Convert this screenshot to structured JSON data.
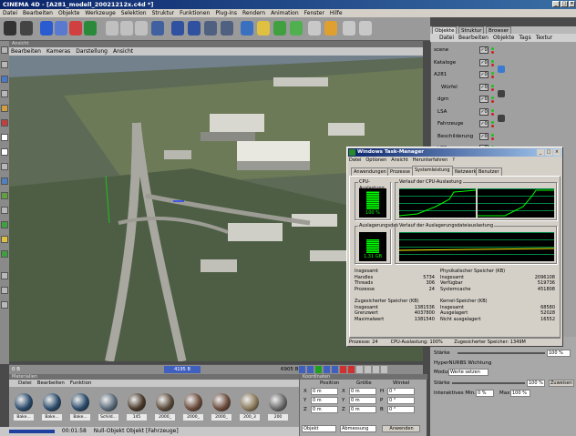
{
  "window": {
    "title": "CINEMA 4D - [A281_modell_20021212x.c4d *]"
  },
  "menubar": [
    "Datei",
    "Bearbeiten",
    "Objekte",
    "Werkzeuge",
    "Selektion",
    "Struktur",
    "Funktionen",
    "Plug-ins",
    "Rendern",
    "Animation",
    "Fenster",
    "Hilfe"
  ],
  "viewport": {
    "header": "Ansicht",
    "menu": [
      "Bearbeiten",
      "Kameras",
      "Darstellung",
      "Ansicht"
    ]
  },
  "timeline": {
    "start": "0 B",
    "current": "4195 B",
    "end": "6905 B"
  },
  "materials": {
    "header": "Materialien",
    "menu": [
      "Datei",
      "Bearbeiten",
      "Funktion"
    ],
    "items": [
      "Bake...",
      "Bake...",
      "Bake...",
      "Schild...",
      "145",
      "2000_",
      "2000_",
      "2000_",
      "200_3",
      "200"
    ]
  },
  "coords": {
    "header": "Koordinaten",
    "cols": [
      "Position",
      "Größe",
      "Winkel"
    ],
    "rows": [
      {
        "axis": "X",
        "pos": "0 m",
        "size": "0 m",
        "ang_axis": "H",
        "ang": "0 °"
      },
      {
        "axis": "Y",
        "pos": "0 m",
        "size": "0 m",
        "ang_axis": "P",
        "ang": "0 °"
      },
      {
        "axis": "Z",
        "pos": "0 m",
        "size": "0 m",
        "ang_axis": "B",
        "ang": "0 °"
      }
    ],
    "mode": "Objekt",
    "size_mode": "Abmessung",
    "apply": "Anwenden"
  },
  "status": {
    "time": "00:01:58",
    "text": "Null-Objekt Objekt [Fahrzeuge]"
  },
  "objects_panel": {
    "tabs": [
      "Objekte",
      "Struktur",
      "Browser"
    ],
    "menu": [
      "Datei",
      "Bearbeiten",
      "Objekte",
      "Tags",
      "Textur"
    ],
    "items": [
      {
        "name": "scene",
        "check": "✓0"
      },
      {
        "name": "Kataloge",
        "check": "✓0"
      },
      {
        "name": "A281",
        "check": "✓0"
      },
      {
        "name": "Würfel",
        "check": "✓0"
      },
      {
        "name": "dgm",
        "check": "✓0"
      },
      {
        "name": "LSA",
        "check": "✓0"
      },
      {
        "name": "Fahrzeuge",
        "check": "✓0"
      },
      {
        "name": "Beschilderung",
        "check": "✓0"
      },
      {
        "name": "LBP",
        "check": "✓0"
      }
    ]
  },
  "attributes": {
    "staerke_label": "Stärke",
    "staerke_val": "100 %",
    "hyper_title": "HyperNURBS Wichtung",
    "mode_label": "Modus",
    "mode_val": "Werte setzen",
    "staerke2_label": "Stärke",
    "staerke2_val": "100 %",
    "apply": "Zuweisen",
    "interactive_label": "Interaktives Min.",
    "min_val": "0 %",
    "max_label": "Max.",
    "max_val": "100 %"
  },
  "taskmgr": {
    "title": "Windows Task-Manager",
    "menu": [
      "Datei",
      "Optionen",
      "Ansicht",
      "Herunterfahren",
      "?"
    ],
    "tabs": [
      "Anwendungen",
      "Prozesse",
      "Systemleistung",
      "Netzwerk",
      "Benutzer"
    ],
    "cpu_label": "CPU-Auslastung",
    "cpu_value": "100 %",
    "cpu_hist_label": "Verlauf der CPU-Auslastung",
    "pf_label": "Auslagerungsdatei",
    "pf_value": "1,31 GB",
    "pf_hist_label": "Verlauf der Auslagerungsdateiauslastung",
    "totals": {
      "title": "Insgesamt",
      "handles_l": "Handles",
      "handles": "5734",
      "threads_l": "Threads",
      "threads": "306",
      "proc_l": "Prozesse",
      "proc": "24"
    },
    "phys": {
      "title": "Physikalischer Speicher (KB)",
      "total_l": "Insgesamt",
      "total": "2096108",
      "avail_l": "Verfügbar",
      "avail": "519736",
      "cache_l": "Systemcache",
      "cache": "451808"
    },
    "commit": {
      "title": "Zugesicherter Speicher (KB)",
      "total_l": "Insgesamt",
      "total": "1381536",
      "limit_l": "Grenzwert",
      "limit": "4037800",
      "peak_l": "Maximalwert",
      "peak": "1381540"
    },
    "kernel": {
      "title": "Kernel-Speicher (KB)",
      "total_l": "Insgesamt",
      "total": "68580",
      "paged_l": "Ausgelagert",
      "paged": "52028",
      "np_l": "Nicht ausgelagert",
      "np": "16552"
    },
    "status": {
      "proc": "Prozesse: 24",
      "cpu": "CPU-Auslastung: 100%",
      "mem": "Zugesicherter Speicher: 1349M"
    }
  },
  "colors": {
    "accent": "#0a246a",
    "graph_green": "#00ff00",
    "graph_bg": "#000000"
  }
}
